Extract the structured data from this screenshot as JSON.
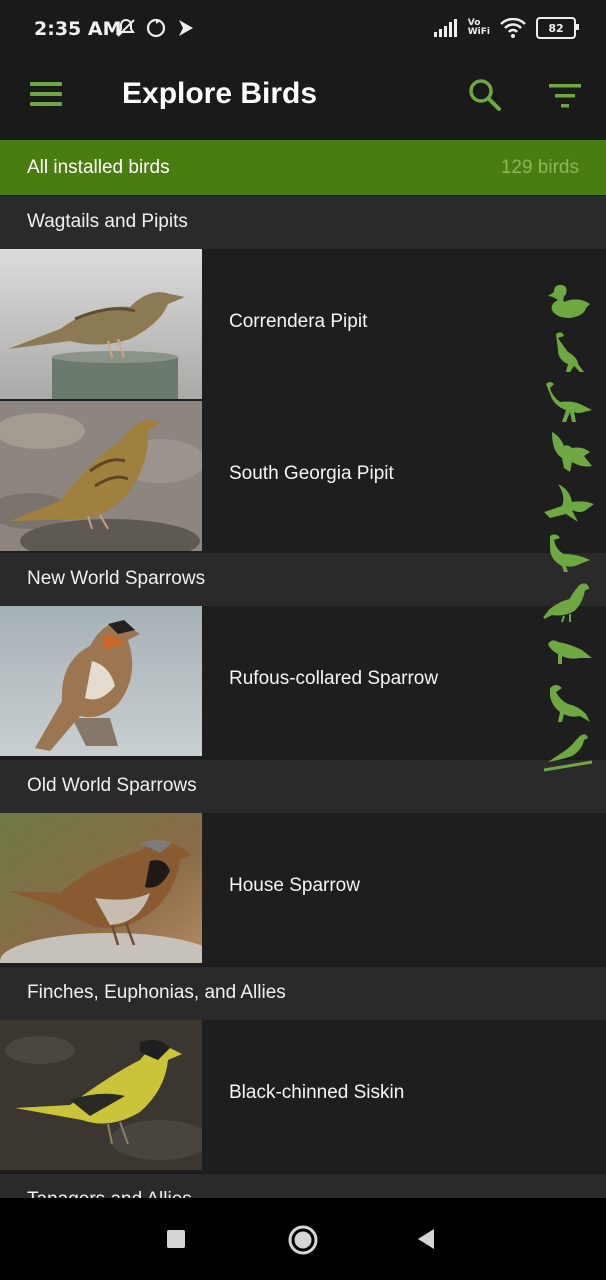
{
  "status": {
    "time": "2:35 AM",
    "vowifi_top": "Vo",
    "vowifi_bottom": "WiFi",
    "battery": "82"
  },
  "app_bar": {
    "title": "Explore Birds",
    "menu_icon": "hamburger-icon",
    "search_icon": "search-icon",
    "filter_icon": "filter-icon",
    "accent": "#6ea842"
  },
  "filter_banner": {
    "label": "All installed birds",
    "count": "129 birds",
    "background": "#4a7d0f"
  },
  "sections": [
    {
      "title": "Wagtails and Pipits",
      "birds": [
        "Correndera Pipit",
        "South Georgia Pipit"
      ]
    },
    {
      "title": "New World Sparrows",
      "birds": [
        "Rufous-collared Sparrow"
      ]
    },
    {
      "title": "Old World Sparrows",
      "birds": [
        "House Sparrow"
      ]
    },
    {
      "title": "Finches, Euphonias, and Allies",
      "birds": [
        "Black-chinned Siskin"
      ]
    },
    {
      "title": "Tanagers and Allies",
      "birds": []
    }
  ],
  "silhouette_filters": [
    "duck-silhouette-icon",
    "heron-standing-icon",
    "heron-walking-icon",
    "raptor-flying-icon",
    "swallow-flying-icon",
    "songbird-icon",
    "perched-bird-icon",
    "small-bird-icon",
    "finch-icon",
    "bird-on-branch-icon"
  ],
  "nav_bar": {
    "icons": [
      "recent-apps-icon",
      "home-icon",
      "back-icon"
    ]
  }
}
